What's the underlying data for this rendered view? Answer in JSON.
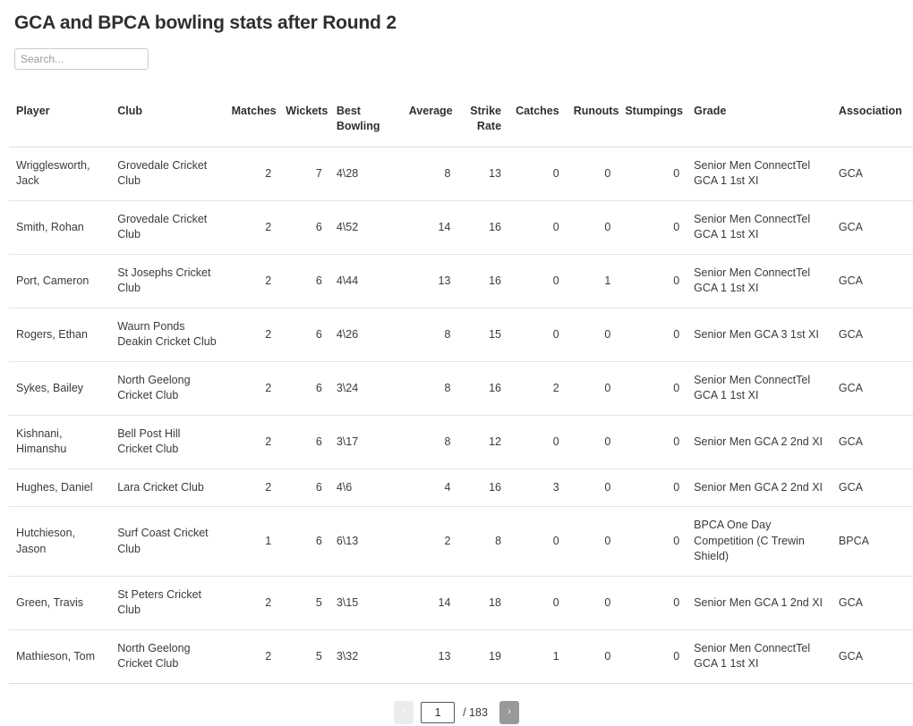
{
  "page_title": "GCA and BPCA bowling stats after Round 2",
  "search": {
    "placeholder": "Search...",
    "value": ""
  },
  "table": {
    "columns": [
      {
        "key": "player",
        "label": "Player",
        "align": "left"
      },
      {
        "key": "club",
        "label": "Club",
        "align": "left"
      },
      {
        "key": "matches",
        "label": "Matches",
        "align": "right"
      },
      {
        "key": "wickets",
        "label": "Wickets",
        "align": "right"
      },
      {
        "key": "best_bowling",
        "label": "Best Bowling",
        "align": "left"
      },
      {
        "key": "average",
        "label": "Average",
        "align": "right"
      },
      {
        "key": "strike_rate",
        "label": "Strike Rate",
        "align": "right"
      },
      {
        "key": "catches",
        "label": "Catches",
        "align": "right"
      },
      {
        "key": "runouts",
        "label": "Runouts",
        "align": "right"
      },
      {
        "key": "stumpings",
        "label": "Stumpings",
        "align": "right"
      },
      {
        "key": "grade",
        "label": "Grade",
        "align": "left"
      },
      {
        "key": "association",
        "label": "Association",
        "align": "left"
      }
    ],
    "rows": [
      {
        "player": "Wrigglesworth, Jack",
        "club": "Grovedale Cricket Club",
        "matches": "2",
        "wickets": "7",
        "best_bowling": "4\\28",
        "average": "8",
        "strike_rate": "13",
        "catches": "0",
        "runouts": "0",
        "stumpings": "0",
        "grade": "Senior Men ConnectTel GCA 1 1st XI",
        "association": "GCA"
      },
      {
        "player": "Smith, Rohan",
        "club": "Grovedale Cricket Club",
        "matches": "2",
        "wickets": "6",
        "best_bowling": "4\\52",
        "average": "14",
        "strike_rate": "16",
        "catches": "0",
        "runouts": "0",
        "stumpings": "0",
        "grade": "Senior Men ConnectTel GCA 1 1st XI",
        "association": "GCA"
      },
      {
        "player": "Port, Cameron",
        "club": "St Josephs Cricket Club",
        "matches": "2",
        "wickets": "6",
        "best_bowling": "4\\44",
        "average": "13",
        "strike_rate": "16",
        "catches": "0",
        "runouts": "1",
        "stumpings": "0",
        "grade": "Senior Men ConnectTel GCA 1 1st XI",
        "association": "GCA"
      },
      {
        "player": "Rogers, Ethan",
        "club": "Waurn Ponds Deakin Cricket Club",
        "matches": "2",
        "wickets": "6",
        "best_bowling": "4\\26",
        "average": "8",
        "strike_rate": "15",
        "catches": "0",
        "runouts": "0",
        "stumpings": "0",
        "grade": "Senior Men GCA 3 1st XI",
        "association": "GCA"
      },
      {
        "player": "Sykes, Bailey",
        "club": "North Geelong Cricket Club",
        "matches": "2",
        "wickets": "6",
        "best_bowling": "3\\24",
        "average": "8",
        "strike_rate": "16",
        "catches": "2",
        "runouts": "0",
        "stumpings": "0",
        "grade": "Senior Men ConnectTel GCA 1 1st XI",
        "association": "GCA"
      },
      {
        "player": "Kishnani, Himanshu",
        "club": "Bell Post Hill Cricket Club",
        "matches": "2",
        "wickets": "6",
        "best_bowling": "3\\17",
        "average": "8",
        "strike_rate": "12",
        "catches": "0",
        "runouts": "0",
        "stumpings": "0",
        "grade": "Senior Men GCA 2 2nd XI",
        "association": "GCA"
      },
      {
        "player": "Hughes, Daniel",
        "club": "Lara Cricket Club",
        "matches": "2",
        "wickets": "6",
        "best_bowling": "4\\6",
        "average": "4",
        "strike_rate": "16",
        "catches": "3",
        "runouts": "0",
        "stumpings": "0",
        "grade": "Senior Men GCA 2 2nd XI",
        "association": "GCA"
      },
      {
        "player": "Hutchieson, Jason",
        "club": "Surf Coast Cricket Club",
        "matches": "1",
        "wickets": "6",
        "best_bowling": "6\\13",
        "average": "2",
        "strike_rate": "8",
        "catches": "0",
        "runouts": "0",
        "stumpings": "0",
        "grade": "BPCA One Day Competition (C Trewin Shield)",
        "association": "BPCA"
      },
      {
        "player": "Green, Travis",
        "club": "St Peters Cricket Club",
        "matches": "2",
        "wickets": "5",
        "best_bowling": "3\\15",
        "average": "14",
        "strike_rate": "18",
        "catches": "0",
        "runouts": "0",
        "stumpings": "0",
        "grade": "Senior Men GCA 1 2nd XI",
        "association": "GCA"
      },
      {
        "player": "Mathieson, Tom",
        "club": "North Geelong Cricket Club",
        "matches": "2",
        "wickets": "5",
        "best_bowling": "3\\32",
        "average": "13",
        "strike_rate": "19",
        "catches": "1",
        "runouts": "0",
        "stumpings": "0",
        "grade": "Senior Men ConnectTel GCA 1 1st XI",
        "association": "GCA"
      }
    ]
  },
  "pagination": {
    "prev_label": "‹",
    "next_label": "›",
    "current_page": "1",
    "total_label": "/ 183",
    "total_pages": "183"
  }
}
